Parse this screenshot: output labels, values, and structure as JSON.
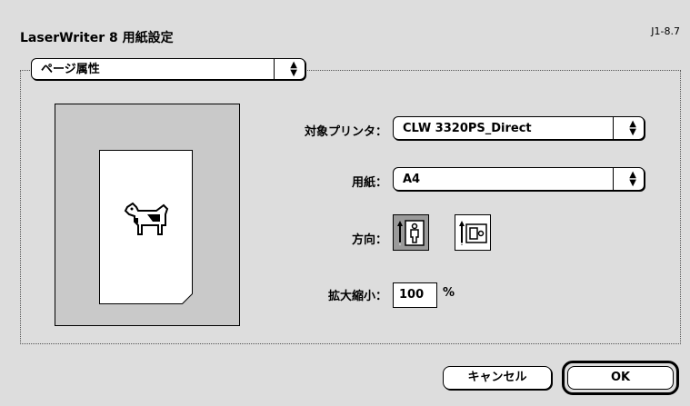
{
  "window": {
    "title": "LaserWriter 8 用紙設定",
    "version": "J1-8.7"
  },
  "section_popup": {
    "value": "ページ属性"
  },
  "printer": {
    "label": "対象プリンタ：",
    "value": "CLW 3320PS_Direct"
  },
  "paper": {
    "label": "用紙：",
    "value": "A4"
  },
  "orientation": {
    "label": "方向：",
    "selected": "portrait"
  },
  "scale": {
    "label": "拡大縮小：",
    "value": "100",
    "unit": "%"
  },
  "buttons": {
    "cancel": "キャンセル",
    "ok": "OK"
  }
}
